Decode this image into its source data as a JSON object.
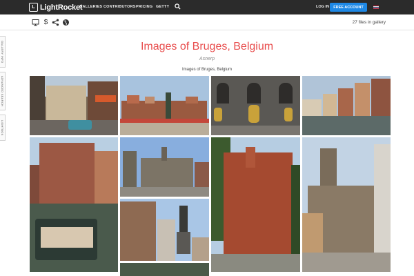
{
  "nav": {
    "logo_mark": "L",
    "logo": "LightRocket",
    "items": [
      "GALLERIES",
      "CONTRIBUTORS",
      "PRICING",
      "GETTY"
    ],
    "login": "LOG IN",
    "cta": "FREE ACCOUNT"
  },
  "toolbar": {
    "price_symbol": "$",
    "files": "27 files in gallery"
  },
  "side_tabs": [
    "GALLERY INFO",
    "ADVANCED SEARCH",
    "LIGHTBOX"
  ],
  "gallery": {
    "title": "Images of Bruges, Belgium",
    "author": "Asnerp",
    "caption": "Images of Bruges, Belgium"
  },
  "icons": [
    "monitor-icon",
    "dollar-icon",
    "share-icon",
    "globe-icon",
    "search-icon",
    "flag-icon"
  ],
  "colors": {
    "nav_bg": "#2b2b2b",
    "cta": "#1e88e5",
    "title": "#e84d4d"
  }
}
